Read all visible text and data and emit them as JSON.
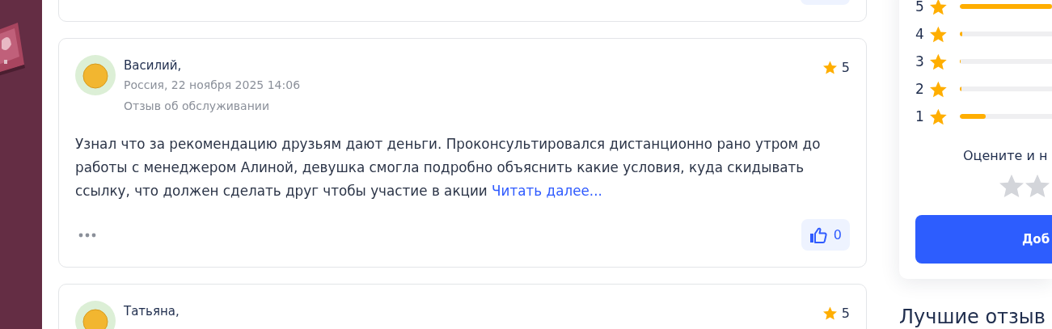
{
  "reviews": [
    {
      "kind": "partial"
    },
    {
      "kind": "full",
      "author": "Василий,",
      "meta": "Россия, 22 ноября 2025 14:06",
      "category": "Отзыв об обслуживании",
      "rating": "5",
      "text": "Узнал что за рекомендацию друзьям дают деньги. Проконсультировался дистанционно рано утром до работы с менеджером Алиной, девушка смогла подробно объяснить какие условия, куда скидывать ссылку, что должен сделать друг чтобы участие в акции",
      "read_more": "Читать далее...",
      "likes": "0"
    },
    {
      "kind": "top",
      "author": "Татьяна,",
      "rating": "5"
    }
  ],
  "rating_summary": {
    "rows": [
      {
        "label": "5",
        "level": 1
      },
      {
        "label": "4",
        "level": 0.03
      },
      {
        "label": "3",
        "level": 0.01
      },
      {
        "label": "2",
        "level": 0.02
      },
      {
        "label": "1",
        "level": 0.28
      }
    ],
    "prompt": "Оцените и н",
    "button": "Доб"
  },
  "best_heading": "Лучшие отзыв"
}
